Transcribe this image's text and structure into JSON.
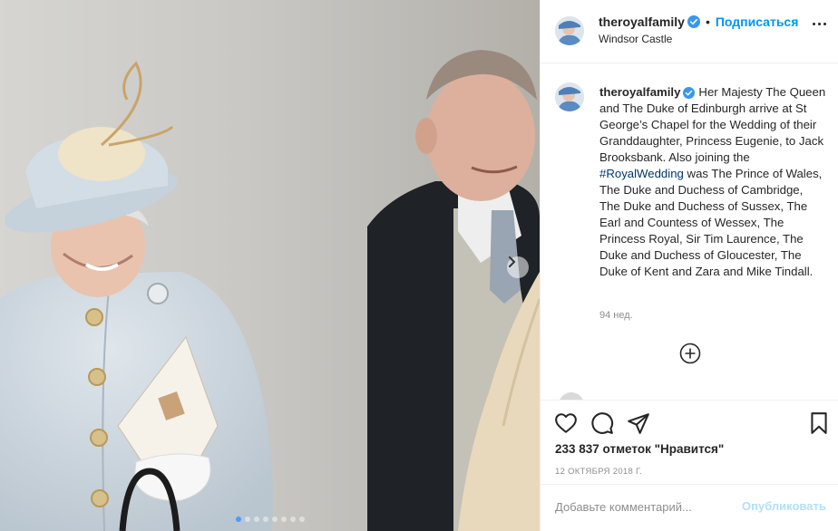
{
  "post": {
    "username": "theroyalfamily",
    "verified": true,
    "follow_label": "Подписаться",
    "separator": "•",
    "location": "Windsor Castle",
    "caption_text": "Her Majesty The Queen and The Duke of Edinburgh arrive at St George’s Chapel for the Wedding of their Granddaughter, Princess Eugenie, to Jack Brooksbank. Also joining the",
    "hashtag": "#RoyalWedding",
    "caption_text_after": "was The Prince of Wales, The Duke and Duchess of Cambridge, The Duke and Duchess of Sussex, The Earl and Countess of Wessex, The Princess Royal, Sir Tim Laurence, The Duke and Duchess of Gloucester, The Duke of Kent and Zara and Mike Tindall.",
    "age": "94 нед.",
    "likes": "233 837 отметок \"Нравится\"",
    "date": "12 ОКТЯБРЯ 2018 Г."
  },
  "carousel": {
    "total_slides": 8,
    "active_index": 0
  },
  "comment": {
    "placeholder": "Добавьте комментарий...",
    "publish_label": "Опубликовать"
  },
  "colors": {
    "accent": "#0095f6",
    "verified": "#3897f0",
    "hashtag": "#00376b",
    "publish_disabled": "#b2dffc",
    "muted": "#8e8e8e"
  },
  "icons": [
    "chevron-right-icon",
    "verified-badge-icon",
    "more-options-icon",
    "plus-circle-icon",
    "heart-icon",
    "comment-icon",
    "share-icon",
    "bookmark-icon"
  ]
}
